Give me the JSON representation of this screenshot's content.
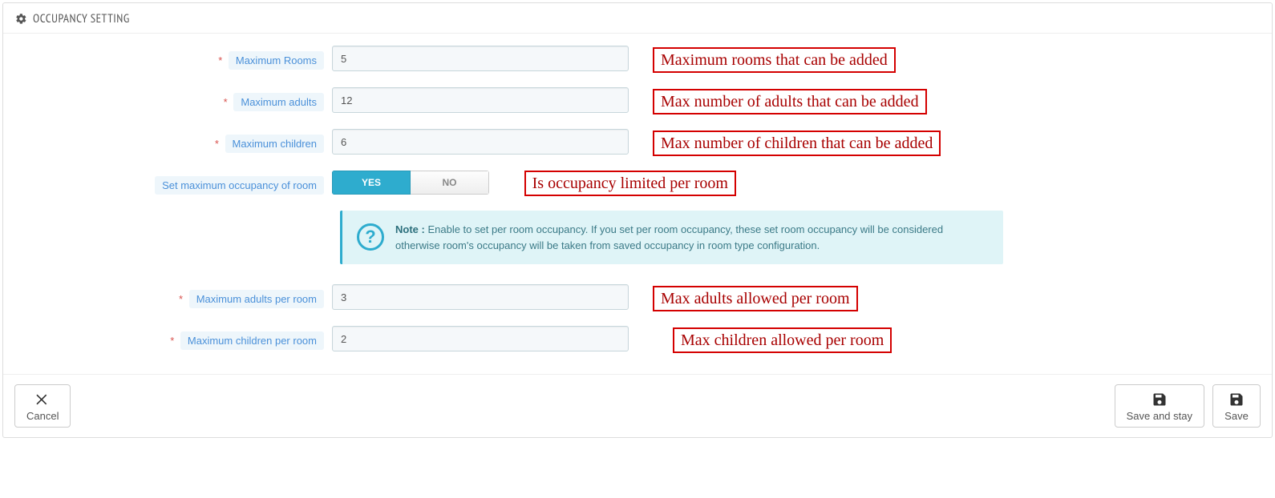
{
  "panel": {
    "title": "OCCUPANCY SETTING"
  },
  "fields": {
    "max_rooms": {
      "label": "Maximum Rooms",
      "value": "5",
      "required": true
    },
    "max_adults": {
      "label": "Maximum adults",
      "value": "12",
      "required": true
    },
    "max_children": {
      "label": "Maximum children",
      "value": "6",
      "required": true
    },
    "set_room_occ": {
      "label": "Set maximum occupancy of room",
      "yes": "YES",
      "no": "NO",
      "value": true
    },
    "max_adults_room": {
      "label": "Maximum adults per room",
      "value": "3",
      "required": true
    },
    "max_children_room": {
      "label": "Maximum children per room",
      "value": "2",
      "required": true
    }
  },
  "note": {
    "prefix": "Note :",
    "text": "Enable to set per room occupancy. If you set per room occupancy, these set room occupancy will be considered otherwise room's occupancy will be taken from saved occupancy in room type configuration."
  },
  "annotations": {
    "rooms": "Maximum rooms that can be added",
    "adults": "Max number of adults that can be added",
    "children": "Max number of children that can be added",
    "occ": "Is occupancy limited per room",
    "adults_room": "Max adults allowed per room",
    "children_room": "Max children allowed per room"
  },
  "buttons": {
    "cancel": "Cancel",
    "save_stay": "Save and stay",
    "save": "Save"
  }
}
